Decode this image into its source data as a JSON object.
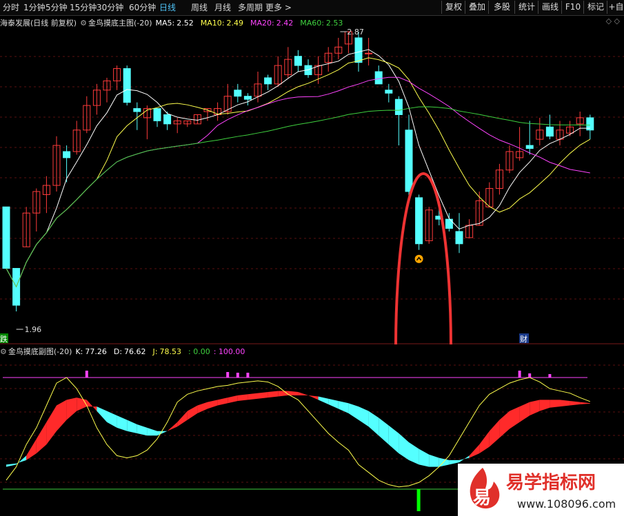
{
  "toolbar": {
    "periods": [
      "分时",
      "1分钟",
      "5分钟",
      "15分钟",
      "30分钟",
      "60分钟",
      "日线",
      "周线",
      "月线",
      "多周期",
      "更多 >"
    ],
    "active_period": "日线",
    "right_buttons": [
      "复权",
      "叠加",
      "多股",
      "统计",
      "画线",
      "F10",
      "标记"
    ],
    "right_extra": "+自"
  },
  "main_chart": {
    "stock_title": "海泰发展(日线 前复权)",
    "indicator_name": "金鸟摸底主图(-20)",
    "ma5_label": "MA5:",
    "ma5_value": "2.52",
    "ma10_label": "MA10:",
    "ma10_value": "2.49",
    "ma20_label": "MA20:",
    "ma20_value": "2.42",
    "ma60_label": "MA60:",
    "ma60_value": "2.53",
    "high_marker": "2.87",
    "low_marker": "1.96",
    "tag_left": "跌",
    "tag_right": "财",
    "colors": {
      "up": "#ff3b3b",
      "down": "#54ffff",
      "ma5": "#ffffff",
      "ma10": "#ffff4d",
      "ma20": "#ff44ff",
      "ma60": "#3fd13f"
    }
  },
  "sub_chart": {
    "indicator_name": "金鸟摸底副图(-20)",
    "k_label": "K:",
    "k_value": "77.26",
    "d_label": "D:",
    "d_value": "76.62",
    "j_label": "J:",
    "j_value": "78.53",
    "v1": ": 0.00",
    "v2": ": 100.00"
  },
  "chart_data": {
    "type": "candlestick",
    "y_range": [
      1.96,
      2.87
    ],
    "candles": [
      [
        2.3,
        2.1,
        2.3,
        2.1
      ],
      [
        2.1,
        1.98,
        2.1,
        1.96
      ],
      [
        2.17,
        2.28,
        2.3,
        2.17
      ],
      [
        2.28,
        2.35,
        2.36,
        2.22
      ],
      [
        2.34,
        2.37,
        2.4,
        2.28
      ],
      [
        2.37,
        2.5,
        2.53,
        2.35
      ],
      [
        2.48,
        2.46,
        2.5,
        2.38
      ],
      [
        2.48,
        2.55,
        2.58,
        2.47
      ],
      [
        2.55,
        2.63,
        2.66,
        2.54
      ],
      [
        2.63,
        2.68,
        2.7,
        2.6
      ],
      [
        2.68,
        2.71,
        2.72,
        2.64
      ],
      [
        2.71,
        2.75,
        2.76,
        2.68
      ],
      [
        2.75,
        2.64,
        2.76,
        2.63
      ],
      [
        2.62,
        2.61,
        2.64,
        2.55
      ],
      [
        2.59,
        2.62,
        2.63,
        2.52
      ],
      [
        2.62,
        2.58,
        2.62,
        2.56
      ],
      [
        2.6,
        2.57,
        2.61,
        2.55
      ],
      [
        2.57,
        2.58,
        2.59,
        2.54
      ],
      [
        2.57,
        2.58,
        2.58,
        2.56
      ],
      [
        2.57,
        2.6,
        2.6,
        2.57
      ],
      [
        2.61,
        2.62,
        2.62,
        2.58
      ],
      [
        2.6,
        2.62,
        2.64,
        2.58
      ],
      [
        2.61,
        2.66,
        2.7,
        2.6
      ],
      [
        2.68,
        2.66,
        2.7,
        2.64
      ],
      [
        2.66,
        2.65,
        2.67,
        2.63
      ],
      [
        2.66,
        2.7,
        2.74,
        2.64
      ],
      [
        2.72,
        2.7,
        2.73,
        2.68
      ],
      [
        2.7,
        2.76,
        2.79,
        2.69
      ],
      [
        2.73,
        2.78,
        2.82,
        2.72
      ],
      [
        2.79,
        2.76,
        2.81,
        2.74
      ],
      [
        2.76,
        2.73,
        2.78,
        2.72
      ],
      [
        2.73,
        2.76,
        2.79,
        2.7
      ],
      [
        2.77,
        2.8,
        2.82,
        2.74
      ],
      [
        2.8,
        2.82,
        2.85,
        2.78
      ],
      [
        2.83,
        2.87,
        2.87,
        2.8
      ],
      [
        2.85,
        2.77,
        2.87,
        2.74
      ],
      [
        2.8,
        2.8,
        2.85,
        2.76
      ],
      [
        2.74,
        2.7,
        2.76,
        2.7
      ],
      [
        2.68,
        2.67,
        2.7,
        2.64
      ],
      [
        2.65,
        2.6,
        2.66,
        2.5
      ],
      [
        2.55,
        2.35,
        2.6,
        2.33
      ],
      [
        2.33,
        2.18,
        2.34,
        2.16
      ],
      [
        2.19,
        2.29,
        2.3,
        2.18
      ],
      [
        2.27,
        2.26,
        2.3,
        2.24
      ],
      [
        2.26,
        2.23,
        2.28,
        2.22
      ],
      [
        2.22,
        2.18,
        2.28,
        2.15
      ],
      [
        2.2,
        2.24,
        2.26,
        2.2
      ],
      [
        2.24,
        2.32,
        2.35,
        2.24
      ],
      [
        2.3,
        2.36,
        2.38,
        2.3
      ],
      [
        2.36,
        2.42,
        2.44,
        2.34
      ],
      [
        2.42,
        2.48,
        2.5,
        2.41
      ],
      [
        2.46,
        2.48,
        2.56,
        2.45
      ],
      [
        2.5,
        2.49,
        2.58,
        2.47
      ],
      [
        2.52,
        2.55,
        2.59,
        2.5
      ],
      [
        2.56,
        2.53,
        2.6,
        2.52
      ],
      [
        2.52,
        2.55,
        2.58,
        2.5
      ],
      [
        2.54,
        2.56,
        2.58,
        2.53
      ],
      [
        2.57,
        2.59,
        2.61,
        2.53
      ],
      [
        2.59,
        2.55,
        2.6,
        2.52
      ]
    ]
  }
}
